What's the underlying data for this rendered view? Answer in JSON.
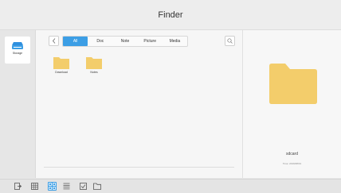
{
  "window": {
    "title": "Finder"
  },
  "sidebar": {
    "items": [
      {
        "label": "Storage",
        "icon": "storage-icon"
      }
    ]
  },
  "toolbar": {
    "tabs": [
      {
        "label": "All",
        "active": true
      },
      {
        "label": "Doc",
        "active": false
      },
      {
        "label": "Note",
        "active": false
      },
      {
        "label": "Picture",
        "active": false
      },
      {
        "label": "Media",
        "active": false
      }
    ]
  },
  "files": [
    {
      "name": "Download",
      "icon": "folder-icon"
    },
    {
      "name": "Notes",
      "icon": "folder-icon"
    }
  ],
  "detail": {
    "name": "sdcard",
    "time": "Time: 2016/08/31"
  },
  "colors": {
    "accent": "#3c9ee5",
    "folder": "#f3cd6b"
  },
  "bottom_bar": {
    "icons": [
      "exit-icon",
      "thumbnail-view-icon",
      "grid-view-icon",
      "list-view-icon",
      "select-icon",
      "new-folder-icon"
    ]
  }
}
